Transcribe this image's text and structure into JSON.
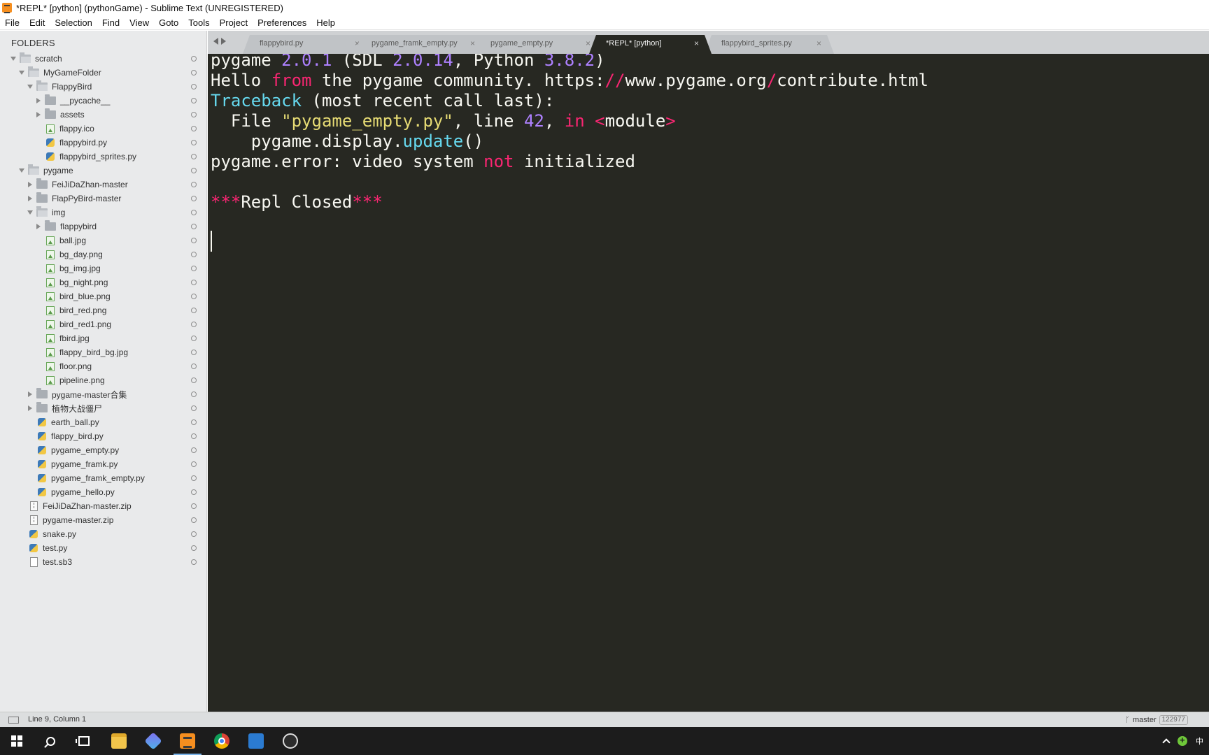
{
  "window": {
    "title": "*REPL* [python] (pythonGame) - Sublime Text (UNREGISTERED)"
  },
  "menu": [
    "File",
    "Edit",
    "Selection",
    "Find",
    "View",
    "Goto",
    "Tools",
    "Project",
    "Preferences",
    "Help"
  ],
  "sidebar": {
    "header": "FOLDERS",
    "items": [
      {
        "label": "scratch",
        "type": "folder-open",
        "arrow": "open",
        "depth": 0
      },
      {
        "label": "MyGameFolder",
        "type": "folder-open",
        "arrow": "open",
        "depth": 1
      },
      {
        "label": "FlappyBird",
        "type": "folder-open",
        "arrow": "open",
        "depth": 2
      },
      {
        "label": "__pycache__",
        "type": "folder",
        "arrow": "closed",
        "depth": 3
      },
      {
        "label": "assets",
        "type": "folder",
        "arrow": "closed",
        "depth": 3
      },
      {
        "label": "flappy.ico",
        "type": "image",
        "arrow": "none",
        "depth": 3
      },
      {
        "label": "flappybird.py",
        "type": "python",
        "arrow": "none",
        "depth": 3
      },
      {
        "label": "flappybird_sprites.py",
        "type": "python",
        "arrow": "none",
        "depth": 3
      },
      {
        "label": "pygame",
        "type": "folder-open",
        "arrow": "open",
        "depth": 1
      },
      {
        "label": "FeiJiDaZhan-master",
        "type": "folder",
        "arrow": "closed",
        "depth": 2
      },
      {
        "label": "FlapPyBird-master",
        "type": "folder",
        "arrow": "closed",
        "depth": 2
      },
      {
        "label": "img",
        "type": "folder-open",
        "arrow": "open",
        "depth": 2
      },
      {
        "label": "flappybird",
        "type": "folder",
        "arrow": "closed",
        "depth": 3
      },
      {
        "label": "ball.jpg",
        "type": "image",
        "arrow": "none",
        "depth": 3
      },
      {
        "label": "bg_day.png",
        "type": "image",
        "arrow": "none",
        "depth": 3
      },
      {
        "label": "bg_img.jpg",
        "type": "image",
        "arrow": "none",
        "depth": 3
      },
      {
        "label": "bg_night.png",
        "type": "image",
        "arrow": "none",
        "depth": 3
      },
      {
        "label": "bird_blue.png",
        "type": "image",
        "arrow": "none",
        "depth": 3
      },
      {
        "label": "bird_red.png",
        "type": "image",
        "arrow": "none",
        "depth": 3
      },
      {
        "label": "bird_red1.png",
        "type": "image",
        "arrow": "none",
        "depth": 3
      },
      {
        "label": "fbird.jpg",
        "type": "image",
        "arrow": "none",
        "depth": 3
      },
      {
        "label": "flappy_bird_bg.jpg",
        "type": "image",
        "arrow": "none",
        "depth": 3
      },
      {
        "label": "floor.png",
        "type": "image",
        "arrow": "none",
        "depth": 3
      },
      {
        "label": "pipeline.png",
        "type": "image",
        "arrow": "none",
        "depth": 3
      },
      {
        "label": "pygame-master合集",
        "type": "folder",
        "arrow": "closed",
        "depth": 2
      },
      {
        "label": "植物大战僵尸",
        "type": "folder",
        "arrow": "closed",
        "depth": 2
      },
      {
        "label": "earth_ball.py",
        "type": "python",
        "arrow": "none",
        "depth": 2
      },
      {
        "label": "flappy_bird.py",
        "type": "python",
        "arrow": "none",
        "depth": 2
      },
      {
        "label": "pygame_empty.py",
        "type": "python",
        "arrow": "none",
        "depth": 2
      },
      {
        "label": "pygame_framk.py",
        "type": "python",
        "arrow": "none",
        "depth": 2
      },
      {
        "label": "pygame_framk_empty.py",
        "type": "python",
        "arrow": "none",
        "depth": 2
      },
      {
        "label": "pygame_hello.py",
        "type": "python",
        "arrow": "none",
        "depth": 2
      },
      {
        "label": "FeiJiDaZhan-master.zip",
        "type": "zip",
        "arrow": "none",
        "depth": 1
      },
      {
        "label": "pygame-master.zip",
        "type": "zip",
        "arrow": "none",
        "depth": 1
      },
      {
        "label": "snake.py",
        "type": "python",
        "arrow": "none",
        "depth": 1
      },
      {
        "label": "test.py",
        "type": "python",
        "arrow": "none",
        "depth": 1
      },
      {
        "label": "test.sb3",
        "type": "file",
        "arrow": "none",
        "depth": 1
      }
    ]
  },
  "tabs": [
    {
      "label": "flappybird.py",
      "active": false
    },
    {
      "label": "pygame_framk_empty.py",
      "active": false
    },
    {
      "label": "pygame_empty.py",
      "active": false
    },
    {
      "label": "*REPL* [python]",
      "active": true
    },
    {
      "label": "flappybird_sprites.py",
      "active": false
    }
  ],
  "tab_close_glyph": "×",
  "editor": {
    "lines": [
      [
        {
          "t": "pygame "
        },
        {
          "t": "2.0.1",
          "c": "num"
        },
        {
          "t": " (SDL "
        },
        {
          "t": "2.0.14",
          "c": "num"
        },
        {
          "t": ", Python "
        },
        {
          "t": "3.8.2",
          "c": "num"
        },
        {
          "t": ")"
        }
      ],
      [
        {
          "t": "Hello "
        },
        {
          "t": "from",
          "c": "kw"
        },
        {
          "t": " the pygame community. https:"
        },
        {
          "t": "//",
          "c": "kw"
        },
        {
          "t": "www.pygame.org"
        },
        {
          "t": "/",
          "c": "kw"
        },
        {
          "t": "contribute.html"
        }
      ],
      [
        {
          "t": "Traceback",
          "c": "fn"
        },
        {
          "t": " (most recent call last):"
        }
      ],
      [
        {
          "t": "  File "
        },
        {
          "t": "\"pygame_empty.py\"",
          "c": "str"
        },
        {
          "t": ", line "
        },
        {
          "t": "42",
          "c": "num"
        },
        {
          "t": ", "
        },
        {
          "t": "in",
          "c": "kw"
        },
        {
          "t": " "
        },
        {
          "t": "<",
          "c": "kw"
        },
        {
          "t": "module"
        },
        {
          "t": ">",
          "c": "kw"
        }
      ],
      [
        {
          "t": "    pygame.display."
        },
        {
          "t": "update",
          "c": "fn"
        },
        {
          "t": "()"
        }
      ],
      [
        {
          "t": "pygame.error: video system "
        },
        {
          "t": "not",
          "c": "kw"
        },
        {
          "t": " initialized"
        }
      ],
      [
        {
          "t": ""
        }
      ],
      [
        {
          "t": "***",
          "c": "kw"
        },
        {
          "t": "Repl Closed"
        },
        {
          "t": "***",
          "c": "kw"
        }
      ]
    ]
  },
  "status": {
    "position": "Line 9, Column 1",
    "branch": "master",
    "branch_badge": "122977"
  },
  "taskbar": {
    "apps": [
      "start",
      "search",
      "task-view",
      "file-explorer",
      "marktext",
      "sublime-text",
      "chrome",
      "vscode",
      "obs"
    ],
    "ime_label": "中"
  }
}
